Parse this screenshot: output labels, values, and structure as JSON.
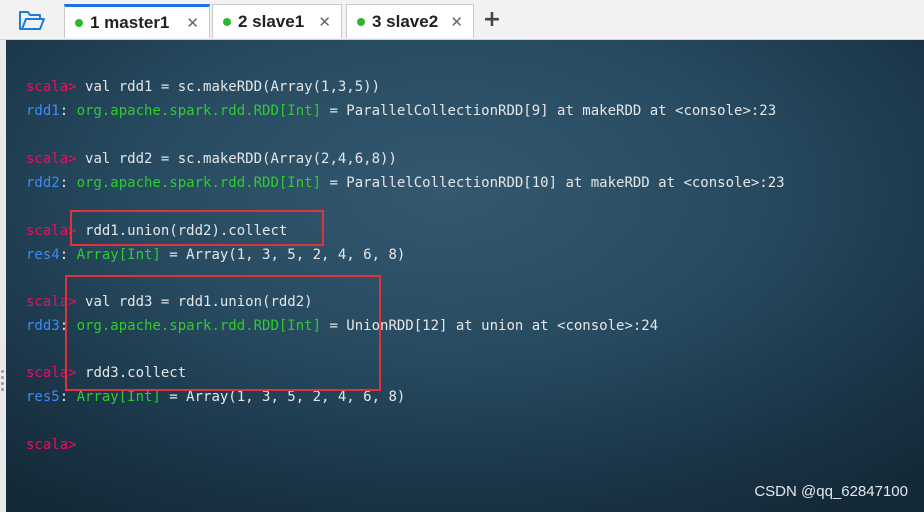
{
  "tabs": [
    {
      "label": "1 master1",
      "active": true,
      "status_color": "#2fb52f"
    },
    {
      "label": "2 slave1",
      "active": false,
      "status_color": "#2fb52f"
    },
    {
      "label": "3 slave2",
      "active": false,
      "status_color": "#2fb52f"
    }
  ],
  "icons": {
    "open_folder": "folder-open-icon",
    "close_tab": "close-icon",
    "new_tab": "plus-icon"
  },
  "new_tab_label": "+",
  "close_glyph": "✕",
  "terminal": {
    "lines": [
      [
        {
          "t": "scala> ",
          "c": "prompt"
        },
        {
          "t": "val rdd1 = sc.makeRDD(Array(1,3,5))",
          "c": "plain"
        }
      ],
      [
        {
          "t": "rdd1",
          "c": "varname"
        },
        {
          "t": ": ",
          "c": "plain"
        },
        {
          "t": "org.apache.spark.rdd.RDD[Int]",
          "c": "typename"
        },
        {
          "t": " = ParallelCollectionRDD[9] at makeRDD at <console>:23",
          "c": "plain"
        }
      ],
      [],
      [
        {
          "t": "scala> ",
          "c": "prompt"
        },
        {
          "t": "val rdd2 = sc.makeRDD(Array(2,4,6,8))",
          "c": "plain"
        }
      ],
      [
        {
          "t": "rdd2",
          "c": "varname"
        },
        {
          "t": ": ",
          "c": "plain"
        },
        {
          "t": "org.apache.spark.rdd.RDD[Int]",
          "c": "typename"
        },
        {
          "t": " = ParallelCollectionRDD[10] at makeRDD at <console>:23",
          "c": "plain"
        }
      ],
      [],
      [
        {
          "t": "scala> ",
          "c": "prompt"
        },
        {
          "t": "rdd1.union(rdd2).collect",
          "c": "plain"
        }
      ],
      [
        {
          "t": "res4",
          "c": "varname"
        },
        {
          "t": ": ",
          "c": "plain"
        },
        {
          "t": "Array[Int]",
          "c": "typename"
        },
        {
          "t": " = Array(1, 3, 5, 2, 4, 6, 8)",
          "c": "plain"
        }
      ],
      [],
      [
        {
          "t": "scala> ",
          "c": "prompt"
        },
        {
          "t": "val rdd3 = rdd1.union(rdd2)",
          "c": "plain"
        }
      ],
      [
        {
          "t": "rdd3",
          "c": "varname"
        },
        {
          "t": ": ",
          "c": "plain"
        },
        {
          "t": "org.apache.spark.rdd.RDD[Int]",
          "c": "typename"
        },
        {
          "t": " = UnionRDD[12] at union at <console>:24",
          "c": "plain"
        }
      ],
      [],
      [
        {
          "t": "scala> ",
          "c": "prompt"
        },
        {
          "t": "rdd3.collect",
          "c": "plain"
        }
      ],
      [
        {
          "t": "res5",
          "c": "varname"
        },
        {
          "t": ": ",
          "c": "plain"
        },
        {
          "t": "Array[Int]",
          "c": "typename"
        },
        {
          "t": " = Array(1, 3, 5, 2, 4, 6, 8)",
          "c": "plain"
        }
      ],
      [],
      [
        {
          "t": "scala>",
          "c": "prompt"
        }
      ]
    ]
  },
  "colors": {
    "prompt": "#e8105e",
    "variable": "#3b8cf7",
    "type": "#2ecc30",
    "text": "#e6e6e6",
    "highlight_box": "#e03238",
    "active_tab_accent": "#1a73e8"
  },
  "watermark": "CSDN @qq_62847100"
}
